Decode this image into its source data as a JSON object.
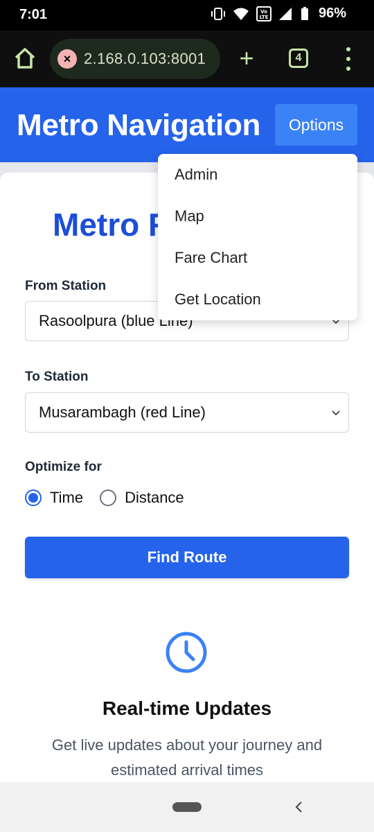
{
  "status_bar": {
    "time": "7:01",
    "battery": "96%",
    "icons": [
      "vibrate-icon",
      "wifi-icon",
      "volte-icon",
      "signal-icon",
      "battery-icon"
    ]
  },
  "browser": {
    "url_partial": "2.168.0.103:8001",
    "tab_count": "4",
    "accent": "#c7e6a5"
  },
  "header": {
    "title": "Metro Navigation",
    "options_label": "Options",
    "color": "#2563eb"
  },
  "dropdown": {
    "items": [
      "Admin",
      "Map",
      "Fare Chart",
      "Get Location"
    ]
  },
  "form": {
    "title_visible": "Metro R",
    "from_label": "From Station",
    "from_value": "Rasoolpura (blue Line)",
    "to_label": "To Station",
    "to_value": "Musarambagh (red Line)",
    "optimize_label": "Optimize for",
    "options": [
      {
        "label": "Time",
        "checked": true
      },
      {
        "label": "Distance",
        "checked": false
      }
    ],
    "submit_label": "Find Route"
  },
  "feature": {
    "icon": "clock-icon",
    "title": "Real-time Updates",
    "description": "Get live updates about your journey and estimated arrival times"
  }
}
